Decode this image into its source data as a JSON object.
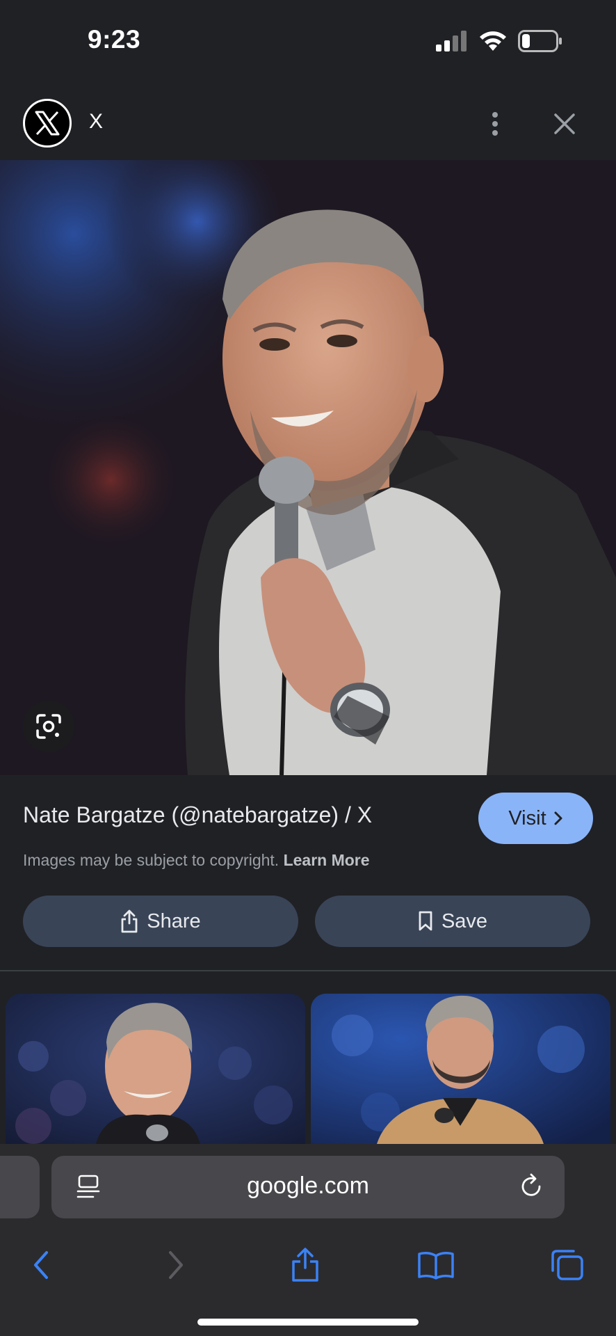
{
  "status_bar": {
    "time": "9:23"
  },
  "header": {
    "site_name": "X"
  },
  "result": {
    "title": "Nate Bargatze (@natebargatze) / X",
    "visit_label": "Visit",
    "copyright_text": "Images may be subject to copyright.",
    "learn_more": "Learn More",
    "share_label": "Share",
    "save_label": "Save"
  },
  "browser": {
    "url": "google.com"
  },
  "colors": {
    "accent": "#8ab4f8",
    "pill": "#394457",
    "background": "#202125"
  }
}
